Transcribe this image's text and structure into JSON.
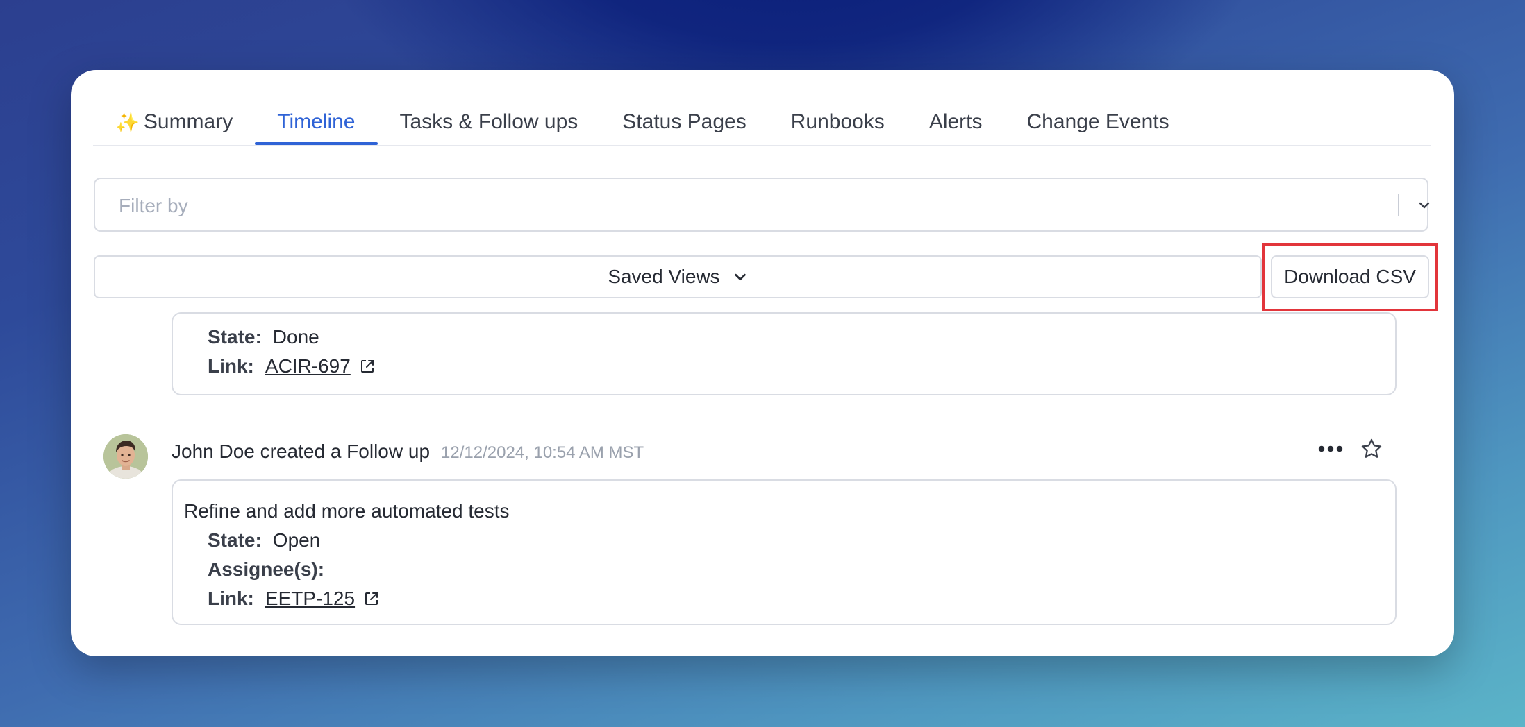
{
  "tabs": [
    {
      "label": "Summary",
      "icon": "sparkles-icon",
      "active": false
    },
    {
      "label": "Timeline",
      "active": true
    },
    {
      "label": "Tasks & Follow ups",
      "active": false
    },
    {
      "label": "Status Pages",
      "active": false
    },
    {
      "label": "Runbooks",
      "active": false
    },
    {
      "label": "Alerts",
      "active": false
    },
    {
      "label": "Change Events",
      "active": false
    }
  ],
  "filter": {
    "placeholder": "Filter by",
    "icon": "chevron-down-icon"
  },
  "saved_views": {
    "label": "Saved Views",
    "icon": "chevron-down-icon"
  },
  "download": {
    "label": "Download CSV",
    "highlight_color": "#e2353b"
  },
  "entries": [
    {
      "state_label": "State:",
      "state": "Done",
      "link_label": "Link:",
      "link": "ACIR-697"
    },
    {
      "author": "John Doe",
      "action": "created a Follow up",
      "timestamp": "12/12/2024, 10:54 AM MST",
      "description": "Refine and add more automated tests",
      "state_label": "State:",
      "state": "Open",
      "assignee_label": "Assignee(s):",
      "link_label": "Link:",
      "link": "EETP-125"
    }
  ],
  "colors": {
    "accent": "#2f63d6"
  }
}
